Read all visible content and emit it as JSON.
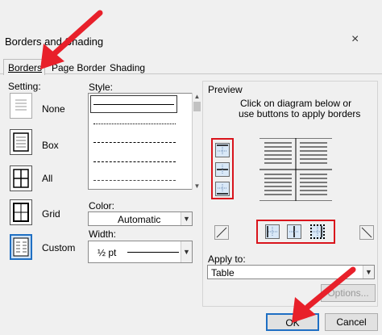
{
  "window": {
    "title": "Borders and Shading",
    "close_label": "×"
  },
  "tabs": [
    {
      "label": "Borders",
      "active": true
    },
    {
      "label": "Page Border",
      "active": false
    },
    {
      "label": "Shading",
      "active": false
    }
  ],
  "setting": {
    "label": "Setting:",
    "options": [
      "None",
      "Box",
      "All",
      "Grid",
      "Custom"
    ],
    "selected": "Custom"
  },
  "style": {
    "label": "Style:"
  },
  "color": {
    "label": "Color:",
    "value": "Automatic"
  },
  "width": {
    "label": "Width:",
    "value": "½ pt"
  },
  "preview": {
    "label": "Preview",
    "instructions_line1": "Click on diagram below or",
    "instructions_line2": "use buttons to apply borders"
  },
  "apply_to": {
    "label": "Apply to:",
    "value": "Table"
  },
  "buttons": {
    "options": "Options...",
    "ok": "OK",
    "cancel": "Cancel"
  },
  "colors": {
    "highlight": "#d9141c",
    "selected_blue": "#1f6fc3",
    "arrow": "#e8202a"
  }
}
